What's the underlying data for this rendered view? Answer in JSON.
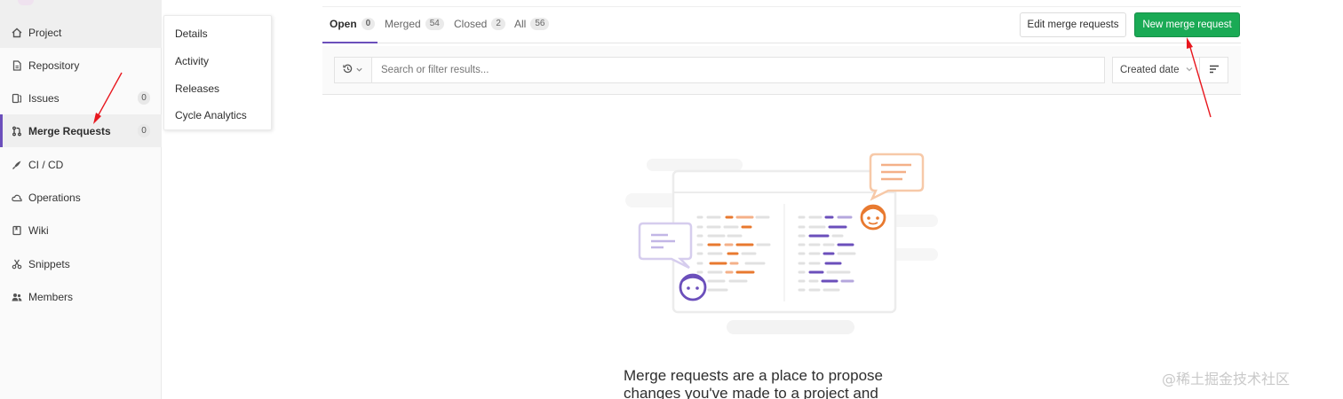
{
  "sidebar": {
    "items": [
      {
        "label": "Project",
        "icon": "home-icon"
      },
      {
        "label": "Repository",
        "icon": "doc-icon"
      },
      {
        "label": "Issues",
        "icon": "issues-icon",
        "count": "0"
      },
      {
        "label": "Merge Requests",
        "icon": "git-merge-icon",
        "count": "0"
      },
      {
        "label": "CI / CD",
        "icon": "rocket-icon"
      },
      {
        "label": "Operations",
        "icon": "cloud-gear-icon"
      },
      {
        "label": "Wiki",
        "icon": "book-icon"
      },
      {
        "label": "Snippets",
        "icon": "scissors-icon"
      },
      {
        "label": "Members",
        "icon": "users-icon"
      }
    ]
  },
  "flyout": {
    "items": [
      "Details",
      "Activity",
      "Releases",
      "Cycle Analytics"
    ]
  },
  "tabs": [
    {
      "label": "Open",
      "count": "0"
    },
    {
      "label": "Merged",
      "count": "54"
    },
    {
      "label": "Closed",
      "count": "2"
    },
    {
      "label": "All",
      "count": "56"
    }
  ],
  "buttons": {
    "edit": "Edit merge requests",
    "new": "New merge request"
  },
  "filter": {
    "placeholder": "Search or filter results...",
    "sort": "Created date"
  },
  "empty_state": {
    "text": "Merge requests are a place to propose changes you've made to a project and"
  },
  "watermark": "@稀土掘金技术社区",
  "colors": {
    "accent": "#6b4fbb",
    "success": "#1aaa55",
    "annotation": "#e8171e"
  }
}
